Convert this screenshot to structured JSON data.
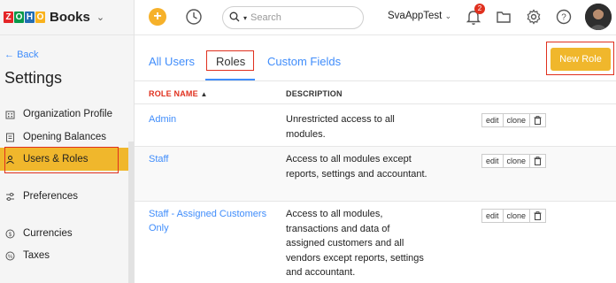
{
  "brand": {
    "logo_letters": [
      "Z",
      "O",
      "H",
      "O"
    ],
    "logo_colors": [
      "#e42527",
      "#089949",
      "#226db4",
      "#f9b21d"
    ],
    "name": "Books"
  },
  "sidebar": {
    "back_label": "Back",
    "title": "Settings",
    "items": [
      {
        "label": "Organization Profile",
        "icon": "building-icon"
      },
      {
        "label": "Opening Balances",
        "icon": "ledger-icon"
      },
      {
        "label": "Users & Roles",
        "icon": "users-icon",
        "active": true
      },
      {
        "label": "Preferences",
        "icon": "sliders-icon"
      },
      {
        "label": "Currencies",
        "icon": "currency-icon"
      },
      {
        "label": "Taxes",
        "icon": "percent-icon"
      }
    ]
  },
  "topbar": {
    "search_placeholder": "Search",
    "org_name": "SvaAppTest",
    "notification_count": "2"
  },
  "tabs": [
    {
      "label": "All Users"
    },
    {
      "label": "Roles",
      "active": true
    },
    {
      "label": "Custom Fields"
    }
  ],
  "new_role_label": "New Role",
  "table": {
    "headers": {
      "name": "ROLE NAME",
      "description": "DESCRIPTION"
    },
    "actions": {
      "edit": "edit",
      "clone": "clone"
    },
    "rows": [
      {
        "name": "Admin",
        "description": "Unrestricted access to all modules."
      },
      {
        "name": "Staff",
        "description": "Access to all modules except reports, settings and accountant."
      },
      {
        "name": "Staff - Assigned Customers Only",
        "description": "Access to all modules, transactions and data of assigned customers and all vendors except reports, settings and accountant."
      }
    ]
  },
  "colors": {
    "accent": "#408dfb",
    "active_bg": "#f0b72c",
    "highlight": "#e0301e"
  }
}
